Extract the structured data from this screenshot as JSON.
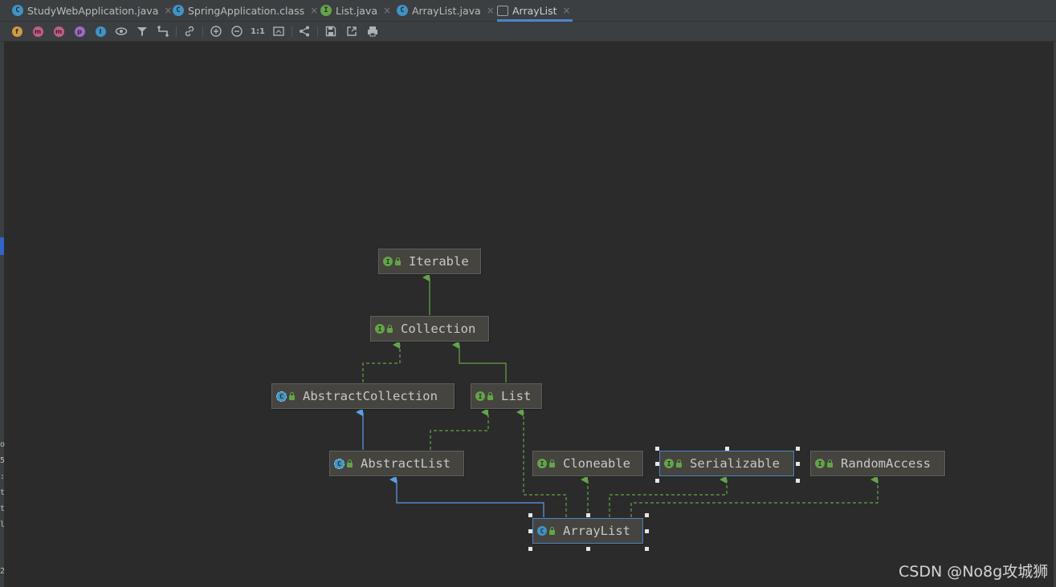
{
  "tabs": [
    {
      "label": "StudyWebApplication.java",
      "icon": "class-icon",
      "active": false
    },
    {
      "label": "SpringApplication.class",
      "icon": "class-icon",
      "active": false
    },
    {
      "label": "List.java",
      "icon": "interface-icon",
      "active": false
    },
    {
      "label": "ArrayList.java",
      "icon": "class-icon",
      "active": false
    },
    {
      "label": "ArrayList",
      "icon": "diagram-icon",
      "active": true
    }
  ],
  "toolbar": {
    "fields_label": "f",
    "constructors_label": "m",
    "methods_label": "m",
    "properties_label": "p",
    "inner_label": "I",
    "actual_size_label": "1:1",
    "colors": {
      "fields": "#d19b3d",
      "constructors": "#c75d84",
      "methods": "#c75d84",
      "properties": "#9b6bc7",
      "inner": "#3f93c7"
    }
  },
  "gutter": {
    "left_chars": [
      "o",
      "5",
      ":",
      "t",
      "t",
      "l",
      "2"
    ]
  },
  "diagram": {
    "nodes": {
      "iterable": {
        "name": "Iterable",
        "kind": "interface"
      },
      "collection": {
        "name": "Collection",
        "kind": "interface"
      },
      "abstract_collection": {
        "name": "AbstractCollection",
        "kind": "abstract-class"
      },
      "list": {
        "name": "List",
        "kind": "interface"
      },
      "abstract_list": {
        "name": "AbstractList",
        "kind": "abstract-class"
      },
      "cloneable": {
        "name": "Cloneable",
        "kind": "interface"
      },
      "serializable": {
        "name": "Serializable",
        "kind": "interface",
        "selected": true
      },
      "random_access": {
        "name": "RandomAccess",
        "kind": "interface"
      },
      "array_list": {
        "name": "ArrayList",
        "kind": "class",
        "selected": true
      }
    },
    "edges": [
      {
        "from": "Collection",
        "to": "Iterable",
        "type": "extends-interface"
      },
      {
        "from": "AbstractCollection",
        "to": "Collection",
        "type": "implements"
      },
      {
        "from": "List",
        "to": "Collection",
        "type": "extends-interface"
      },
      {
        "from": "AbstractList",
        "to": "AbstractCollection",
        "type": "extends-class"
      },
      {
        "from": "AbstractList",
        "to": "List",
        "type": "implements"
      },
      {
        "from": "ArrayList",
        "to": "AbstractList",
        "type": "extends-class"
      },
      {
        "from": "ArrayList",
        "to": "List",
        "type": "implements"
      },
      {
        "from": "ArrayList",
        "to": "Cloneable",
        "type": "implements"
      },
      {
        "from": "ArrayList",
        "to": "Serializable",
        "type": "implements"
      },
      {
        "from": "ArrayList",
        "to": "RandomAccess",
        "type": "implements"
      }
    ],
    "colors": {
      "interface_edge": "#62a547",
      "class_edge": "#5a9ee8",
      "node_bg": "#45443f"
    }
  },
  "watermark": "CSDN @No8g攻城狮"
}
